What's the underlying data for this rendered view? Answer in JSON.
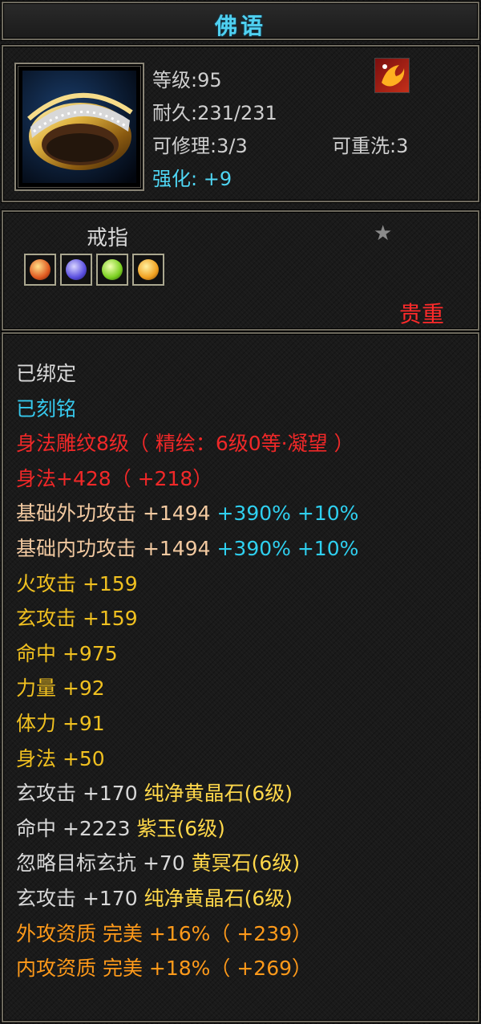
{
  "title": "佛语",
  "header": {
    "level": "等级:95",
    "durability": "耐久:231/231",
    "repair": "可修理:3/3",
    "rewash": "可重洗:3",
    "enhance": "强化: +9"
  },
  "item_icon": "golden-ring-icon",
  "badge_icon": "phoenix-badge-icon",
  "item_type": "戒指",
  "star_icon": "star-icon",
  "gems": [
    {
      "name": "gem-slot-1",
      "color": "#e05a20"
    },
    {
      "name": "gem-slot-2",
      "color": "#5a4fe0"
    },
    {
      "name": "gem-slot-3",
      "color": "#7bd020"
    },
    {
      "name": "gem-slot-4",
      "color": "#f0a020"
    }
  ],
  "rarity": "贵重",
  "bound": "已绑定",
  "engraved": "已刻铭",
  "carving": "身法雕纹8级（ 精绘：6级0等·凝望 ）",
  "agility_total": "身法+428（ +218）",
  "outer_attack": {
    "label": "基础外功攻击  +1494",
    "pct": " +390%",
    "extra": " +10%"
  },
  "inner_attack": {
    "label": "基础内功攻击  +1494",
    "pct": " +390%",
    "extra": " +10%"
  },
  "stats": [
    "火攻击  +159",
    "玄攻击  +159",
    "命中  +975",
    "力量  +92",
    "体力  +91",
    "身法  +50"
  ],
  "gem_lines": [
    {
      "stat": "玄攻击  +170 ",
      "gem": "纯净黄晶石(6级)"
    },
    {
      "stat": "命中  +2223 ",
      "gem": "紫玉(6级)"
    },
    {
      "stat": "忽略目标玄抗  +70 ",
      "gem": "黄冥石(6级)"
    },
    {
      "stat": "玄攻击  +170 ",
      "gem": "纯净黄晶石(6级)"
    }
  ],
  "aptitude": [
    "外攻资质  完美 +16%（ +239）",
    "内攻资质  完美 +18%（ +269）"
  ],
  "colors": {
    "title": "#4fd0f0",
    "rarity": "#ff2a2a",
    "enhance": "#4fd6f4"
  }
}
